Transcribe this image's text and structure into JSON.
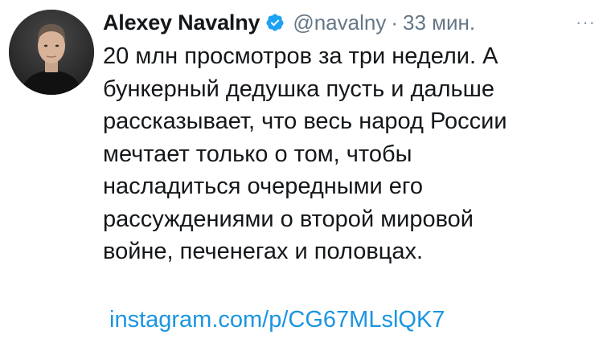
{
  "tweet": {
    "author_name": "Alexey Navalny",
    "handle": "@navalny",
    "separator": "·",
    "time": "33 мин.",
    "more": "···",
    "lines": [
      "20 млн просмотров за три недели. А",
      "бункерный дедушка пусть и дальше",
      "рассказывает, что весь народ России",
      "мечтает только о том, чтобы",
      "насладиться очередными его",
      "рассуждениями о второй мировой",
      "войне, печенегах и половцах."
    ],
    "link": "instagram.com/p/CG67MLslQK7"
  },
  "colors": {
    "link": "#1b95e0",
    "verified_badge": "#1da1f2",
    "muted": "#657786",
    "text": "#14171a"
  },
  "icons": {
    "verified": "verified-badge-icon",
    "more": "more-dots-icon"
  }
}
